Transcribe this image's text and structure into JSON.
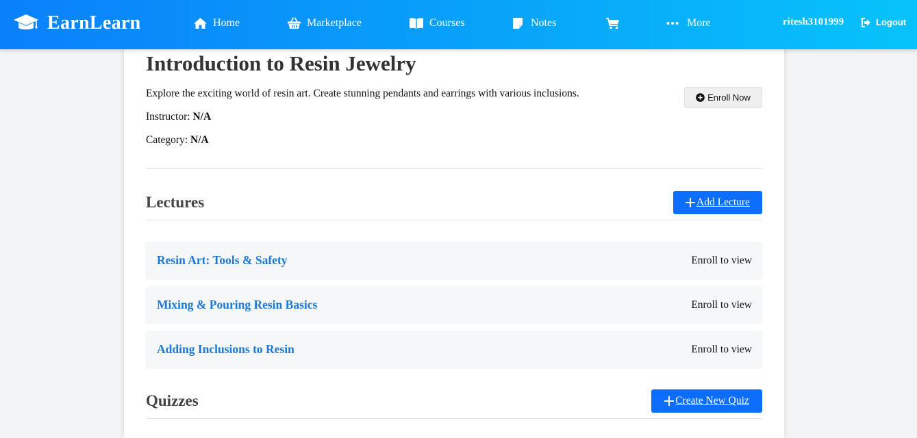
{
  "navbar": {
    "brand": "EarnLearn",
    "items": [
      {
        "label": "Home",
        "icon": "home-icon"
      },
      {
        "label": "Marketplace",
        "icon": "basket-icon"
      },
      {
        "label": "Courses",
        "icon": "book-open-icon"
      },
      {
        "label": "Notes",
        "icon": "sticky-note-icon"
      },
      {
        "label": "",
        "icon": "cart-icon"
      },
      {
        "label": "More",
        "icon": "ellipsis-icon"
      }
    ],
    "username": "ritesh3101999",
    "logout_label": "Logout"
  },
  "course": {
    "title": "Introduction to Resin Jewelry",
    "description": "Explore the exciting world of resin art. Create stunning pendants and earrings with various inclusions.",
    "instructor_label": "Instructor:",
    "instructor_value": "N/A",
    "category_label": "Category:",
    "category_value": "N/A",
    "enroll_label": "Enroll Now"
  },
  "lectures": {
    "heading": "Lectures",
    "add_label": "Add Lecture",
    "items": [
      {
        "title": "Resin Art: Tools & Safety",
        "status": "Enroll to view"
      },
      {
        "title": "Mixing & Pouring Resin Basics",
        "status": "Enroll to view"
      },
      {
        "title": "Adding Inclusions to Resin",
        "status": "Enroll to view"
      }
    ]
  },
  "quizzes": {
    "heading": "Quizzes",
    "create_label": "Create New Quiz"
  },
  "colors": {
    "nav_gradient_start": "#0a80fb",
    "nav_gradient_end": "#07c3fa",
    "primary_button": "#0d6efd",
    "lecture_link": "#1c78d4"
  }
}
